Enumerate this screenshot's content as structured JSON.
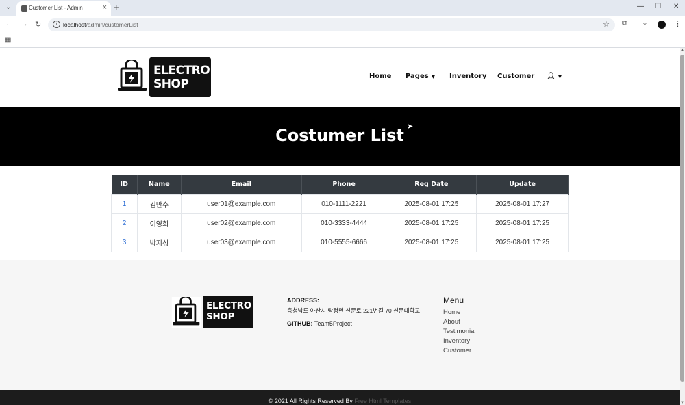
{
  "browser": {
    "tab_title": "Customer List - Admin",
    "url_host": "localhost",
    "url_path": "/admin/customerList"
  },
  "header": {
    "logo_line1": "ELECTRO",
    "logo_line2": "SHOP",
    "nav": [
      {
        "label": "Home"
      },
      {
        "label": "Pages"
      },
      {
        "label": "Inventory"
      },
      {
        "label": "Customer"
      }
    ]
  },
  "banner": {
    "title": "Costumer List"
  },
  "table": {
    "columns": [
      "ID",
      "Name",
      "Email",
      "Phone",
      "Reg Date",
      "Update"
    ],
    "rows": [
      {
        "id": "1",
        "name": "김만수",
        "email": "user01@example.com",
        "phone": "010-1111-2221",
        "reg": "2025-08-01 17:25",
        "update": "2025-08-01 17:27"
      },
      {
        "id": "2",
        "name": "이영희",
        "email": "user02@example.com",
        "phone": "010-3333-4444",
        "reg": "2025-08-01 17:25",
        "update": "2025-08-01 17:25"
      },
      {
        "id": "3",
        "name": "박지성",
        "email": "user03@example.com",
        "phone": "010-5555-6666",
        "reg": "2025-08-01 17:25",
        "update": "2025-08-01 17:25"
      }
    ]
  },
  "footer": {
    "logo_line1": "ELECTRO",
    "logo_line2": "SHOP",
    "address_label": "ADDRESS:",
    "address": "충청남도 아산시 탕정면 선문로 221번길 70 선문대학교",
    "github_label": "GITHUB:",
    "github_value": "Team5Project",
    "menu_title": "Menu",
    "menu": [
      "Home",
      "About",
      "Testimonial",
      "Inventory",
      "Customer"
    ],
    "copyright": "© 2021 All Rights Reserved By",
    "copyright_link": "Free Html Templates"
  },
  "colors": {
    "banner_bg": "#000000",
    "table_header_bg": "#343a40",
    "id_link": "#2b6cd4",
    "footer_bg": "#f6f6f6"
  }
}
